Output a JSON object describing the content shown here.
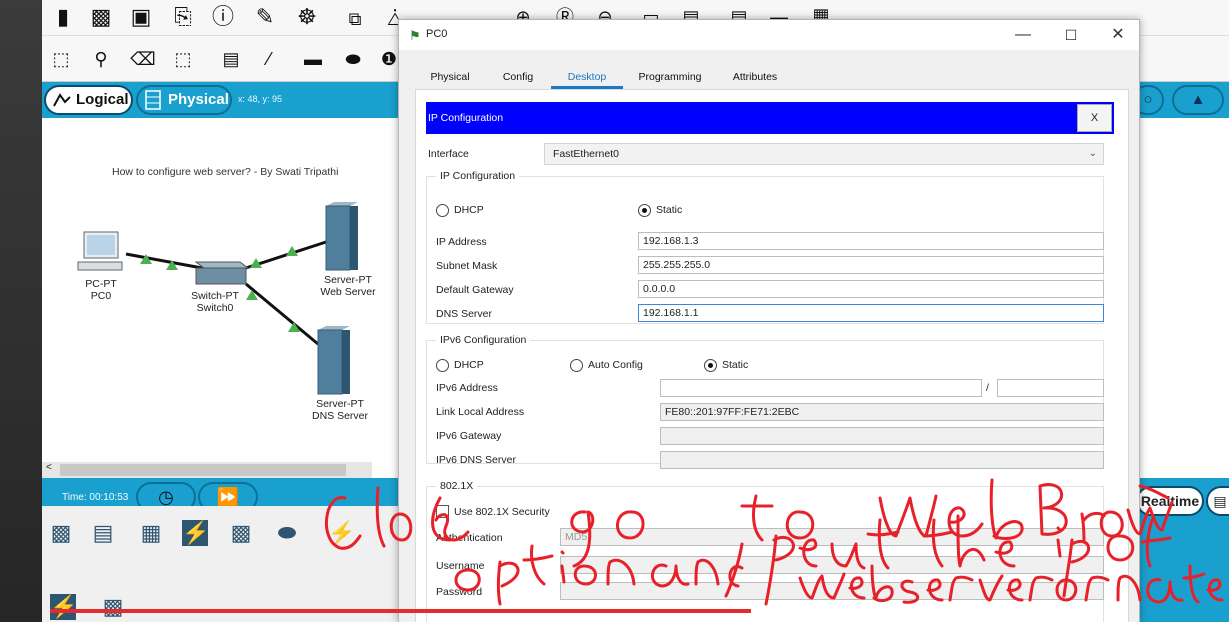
{
  "toolbar": {
    "icons": [
      "new-file-icon",
      "open-folder-icon",
      "save-icon",
      "print-icon",
      "info-icon",
      "activity-wizard-icon",
      "user-icon",
      "copy-icon",
      "paste-icon",
      "undo-icon",
      "redo-icon",
      "zoom-in-icon",
      "zoom-reset-icon",
      "zoom-out-icon",
      "rectangle-icon",
      "palette-icon",
      "notes-icon",
      "workspace-icon",
      "image-icon"
    ],
    "draw_tools": [
      "select-icon",
      "search-icon",
      "delete-icon",
      "resize-icon",
      "note-icon",
      "line-icon",
      "rectangle-icon",
      "ellipse-icon",
      "freeform-icon"
    ]
  },
  "nav": {
    "logical_label": "Logical",
    "physical_label": "Physical",
    "coords": "x: 48, y: 95"
  },
  "workspace": {
    "title": "How to configure web server? - By Swati Tripathi",
    "devices": [
      {
        "type": "PC-PT",
        "name": "PC0"
      },
      {
        "type": "Switch-PT",
        "name": "Switch0"
      },
      {
        "type": "Server-PT",
        "name": "Web Server"
      },
      {
        "type": "Server-PT",
        "name": "DNS Server"
      }
    ]
  },
  "bottom": {
    "time": "Time: 00:10:53",
    "realtime_label": "Realtime"
  },
  "dialog": {
    "title": "PC0",
    "tabs": [
      "Physical",
      "Config",
      "Desktop",
      "Programming",
      "Attributes"
    ],
    "active_tab": "Desktop",
    "ipconfig": {
      "header": "IP Configuration",
      "close_label": "X",
      "interface_label": "Interface",
      "interface_value": "FastEthernet0",
      "ipv4": {
        "group_title": "IP Configuration",
        "dhcp_label": "DHCP",
        "static_label": "Static",
        "mode": "Static",
        "ip_address_label": "IP Address",
        "ip_address": "192.168.1.3",
        "subnet_mask_label": "Subnet Mask",
        "subnet_mask": "255.255.255.0",
        "gateway_label": "Default Gateway",
        "gateway": "0.0.0.0",
        "dns_label": "DNS Server",
        "dns": "192.168.1.1"
      },
      "ipv6": {
        "group_title": "IPv6 Configuration",
        "dhcp_label": "DHCP",
        "auto_label": "Auto Config",
        "static_label": "Static",
        "mode": "Static",
        "address_label": "IPv6 Address",
        "address": "",
        "prefix_sep": "/",
        "link_local_label": "Link Local Address",
        "link_local": "FE80::201:97FF:FE71:2EBC",
        "gateway_label": "IPv6 Gateway",
        "gateway": "",
        "dns_label": "IPv6 DNS Server",
        "dns": ""
      },
      "dot1x": {
        "group_title": "802.1X",
        "use_label": "Use 802.1X Security",
        "auth_label": "Authentication",
        "auth_value": "MD5",
        "username_label": "Username",
        "password_label": "Password"
      }
    }
  },
  "annotation": {
    "text": "Close & go to web Browser option and put the ip of webserver or name",
    "color": "#e8202a"
  },
  "video_progress": 0.6
}
